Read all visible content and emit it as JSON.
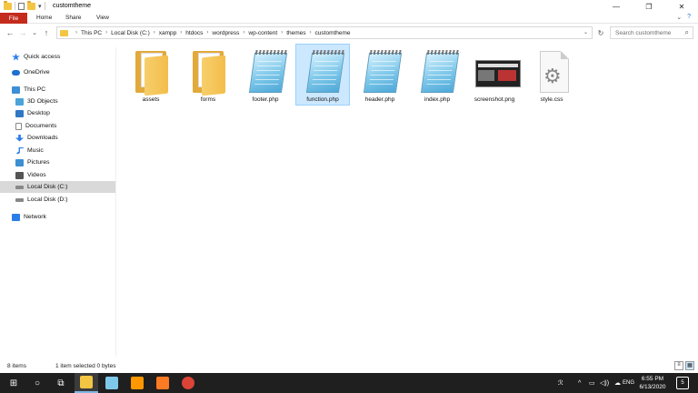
{
  "window": {
    "title": "customtheme"
  },
  "window_controls": {
    "minimize": "—",
    "maximize": "❐",
    "close": "✕"
  },
  "ribbon": {
    "file_label": "File",
    "tabs": [
      "Home",
      "Share",
      "View"
    ],
    "expand_glyph": "⌄",
    "help_glyph": "?"
  },
  "nav": {
    "back": "←",
    "forward": "→",
    "recent": "⌄",
    "up": "↑",
    "refresh": "↻"
  },
  "address": {
    "crumbs": [
      "This PC",
      "Local Disk (C:)",
      "xampp",
      "htdocs",
      "wordpress",
      "wp-content",
      "themes",
      "customtheme"
    ],
    "separator": "›",
    "dropdown": "⌄"
  },
  "search": {
    "placeholder": "Search customtheme",
    "icon": "search-icon",
    "glyph": "⌕"
  },
  "sidebar": {
    "items": [
      {
        "label": "Quick access",
        "icon": "star-icon",
        "color": "#2b7de9"
      },
      {
        "label": "OneDrive",
        "icon": "cloud-icon",
        "color": "#1e6fd1"
      },
      {
        "label": "This PC",
        "icon": "computer-icon",
        "color": "#3d8fd8"
      },
      {
        "label": "3D Objects",
        "icon": "cube-icon",
        "color": "#4ca3d9"
      },
      {
        "label": "Desktop",
        "icon": "desktop-icon",
        "color": "#2f78c4"
      },
      {
        "label": "Documents",
        "icon": "document-icon",
        "color": "#8a8a8a"
      },
      {
        "label": "Downloads",
        "icon": "download-icon",
        "color": "#2b7de9"
      },
      {
        "label": "Music",
        "icon": "music-icon",
        "color": "#2b7de9"
      },
      {
        "label": "Pictures",
        "icon": "pictures-icon",
        "color": "#3c8fd1"
      },
      {
        "label": "Videos",
        "icon": "video-icon",
        "color": "#555555"
      },
      {
        "label": "Local Disk (C:)",
        "icon": "drive-icon",
        "color": "#666666"
      },
      {
        "label": "Local Disk (D:)",
        "icon": "drive-icon",
        "color": "#666666"
      },
      {
        "label": "Network",
        "icon": "network-icon",
        "color": "#2b7de9"
      }
    ]
  },
  "files": [
    {
      "name": "assets",
      "type": "folder"
    },
    {
      "name": "forms",
      "type": "folder"
    },
    {
      "name": "footer.php",
      "type": "notepad"
    },
    {
      "name": "function.php",
      "type": "notepad"
    },
    {
      "name": "header.php",
      "type": "notepad"
    },
    {
      "name": "index.php",
      "type": "notepad"
    },
    {
      "name": "screenshot.png",
      "type": "image"
    },
    {
      "name": "style.css",
      "type": "css"
    }
  ],
  "status": {
    "item_count": "8 items",
    "selection": "1 item selected  0 bytes"
  },
  "taskbar": {
    "start_glyph": "⊞",
    "search_glyph": "○",
    "taskview_glyph": "⧉",
    "apps": [
      {
        "name": "file-explorer",
        "color": "#f4c542"
      },
      {
        "name": "notepad",
        "color": "#7ec8ea"
      },
      {
        "name": "sublime-text",
        "color": "#ff9800"
      },
      {
        "name": "xampp",
        "color": "#fb7a24"
      },
      {
        "name": "chrome",
        "color": "#db4437"
      }
    ],
    "tray_glyphs": [
      "ℛ",
      "^",
      "▭",
      "◁))",
      "☁",
      "ENG"
    ],
    "time": "6:55 PM",
    "date": "6/13/2020",
    "notifications": "5"
  },
  "colors": {
    "file_tab": "#c42b1c",
    "selection": "#cce8ff",
    "taskbar": "#1f1f1f"
  }
}
